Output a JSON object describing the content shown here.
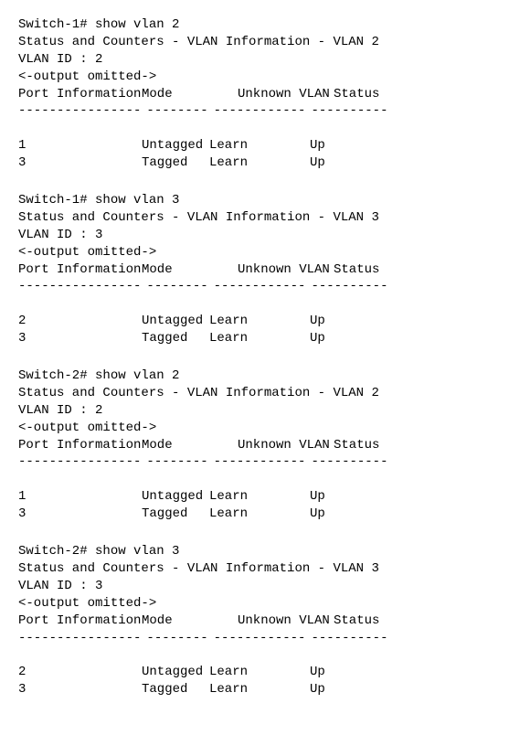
{
  "blocks": [
    {
      "prompt": "Switch-1# show vlan 2",
      "title": "Status and Counters - VLAN Information - VLAN 2",
      "vlan_id": "VLAN ID : 2",
      "omitted": "<-output omitted->",
      "headers": {
        "port": "Port Information",
        "mode": "Mode",
        "uvlan": "Unknown VLAN",
        "status": "Status"
      },
      "dashes": {
        "port": "----------------",
        "mode": "--------",
        "uvlan": "------------",
        "status": "----------"
      },
      "rows": [
        {
          "port": "1",
          "mode": "Untagged",
          "uvlan": "Learn",
          "status": "Up"
        },
        {
          "port": "3",
          "mode": "Tagged",
          "uvlan": "Learn",
          "status": "Up"
        }
      ]
    },
    {
      "prompt": "Switch-1# show vlan 3",
      "title": "Status and Counters - VLAN Information - VLAN 3",
      "vlan_id": "VLAN ID : 3",
      "omitted": "<-output omitted->",
      "headers": {
        "port": "Port Information",
        "mode": "Mode",
        "uvlan": "Unknown VLAN",
        "status": "Status"
      },
      "dashes": {
        "port": "----------------",
        "mode": "--------",
        "uvlan": "------------",
        "status": "----------"
      },
      "rows": [
        {
          "port": "2",
          "mode": "Untagged",
          "uvlan": "Learn",
          "status": "Up"
        },
        {
          "port": "3",
          "mode": "Tagged",
          "uvlan": "Learn",
          "status": "Up"
        }
      ]
    },
    {
      "prompt": "Switch-2# show vlan 2",
      "title": "Status and Counters - VLAN Information - VLAN 2",
      "vlan_id": "VLAN ID : 2",
      "omitted": "<-output omitted->",
      "headers": {
        "port": "Port Information",
        "mode": "Mode",
        "uvlan": "Unknown VLAN",
        "status": "Status"
      },
      "dashes": {
        "port": "----------------",
        "mode": "--------",
        "uvlan": "------------",
        "status": "----------"
      },
      "rows": [
        {
          "port": "1",
          "mode": "Untagged",
          "uvlan": "Learn",
          "status": "Up"
        },
        {
          "port": "3",
          "mode": "Tagged",
          "uvlan": "Learn",
          "status": "Up"
        }
      ]
    },
    {
      "prompt": "Switch-2# show vlan 3",
      "title": "Status and Counters - VLAN Information - VLAN 3",
      "vlan_id": "VLAN ID : 3",
      "omitted": "<-output omitted->",
      "headers": {
        "port": "Port Information",
        "mode": "Mode",
        "uvlan": "Unknown VLAN",
        "status": "Status"
      },
      "dashes": {
        "port": "----------------",
        "mode": "--------",
        "uvlan": "------------",
        "status": "----------"
      },
      "rows": [
        {
          "port": "2",
          "mode": "Untagged",
          "uvlan": "Learn",
          "status": "Up"
        },
        {
          "port": "3",
          "mode": "Tagged",
          "uvlan": "Learn",
          "status": "Up"
        }
      ]
    }
  ]
}
